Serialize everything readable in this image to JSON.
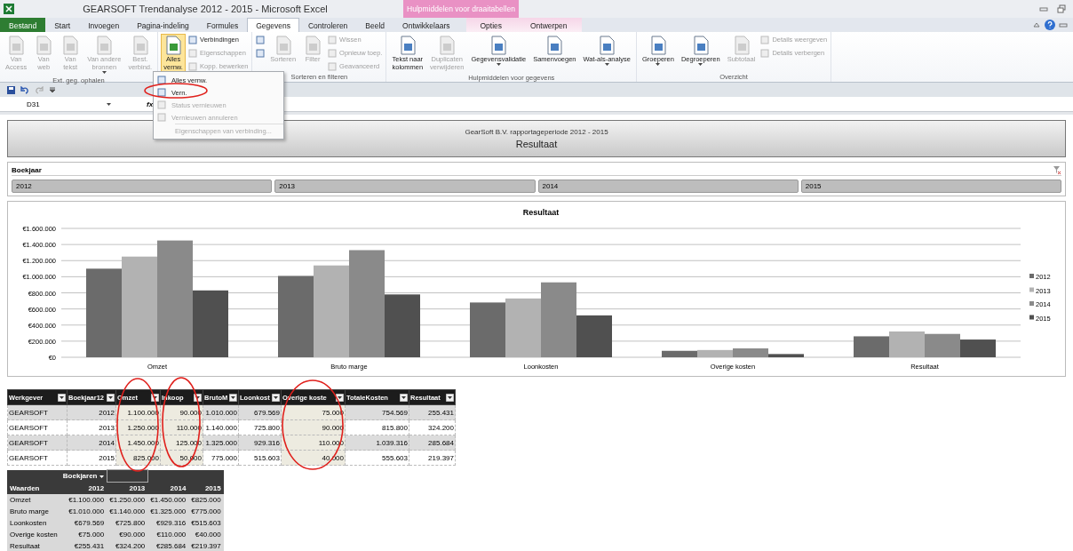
{
  "window": {
    "title": "GEARSOFT Trendanalyse 2012 - 2015  -  Microsoft Excel"
  },
  "tabs": [
    {
      "label": "Bestand",
      "kind": "file",
      "selected": false
    },
    {
      "label": "Start",
      "kind": "tab",
      "selected": false
    },
    {
      "label": "Invoegen",
      "kind": "tab",
      "selected": false
    },
    {
      "label": "Pagina-indeling",
      "kind": "tab",
      "selected": false
    },
    {
      "label": "Formules",
      "kind": "tab",
      "selected": false
    },
    {
      "label": "Gegevens",
      "kind": "tab",
      "selected": true
    },
    {
      "label": "Controleren",
      "kind": "tab",
      "selected": false
    },
    {
      "label": "Beeld",
      "kind": "tab",
      "selected": false
    },
    {
      "label": "Ontwikkelaars",
      "kind": "tab",
      "selected": false
    }
  ],
  "contextual_tabs": {
    "title": "Hulpmiddelen voor draaitabellen",
    "tabs": [
      {
        "label": "Opties",
        "selected": false
      },
      {
        "label": "Ontwerpen",
        "selected": false
      }
    ]
  },
  "ribbon_groups": [
    {
      "label": "Ext. geg. ophalen",
      "items": [
        {
          "kind": "large",
          "lines": [
            "Van",
            "Access"
          ],
          "disabled": true,
          "caret": false,
          "active": false
        },
        {
          "kind": "large",
          "lines": [
            "Van",
            "web"
          ],
          "disabled": true,
          "caret": false,
          "active": false
        },
        {
          "kind": "large",
          "lines": [
            "Van",
            "tekst"
          ],
          "disabled": true,
          "caret": false,
          "active": false
        },
        {
          "kind": "large",
          "lines": [
            "Van andere",
            "bronnen"
          ],
          "disabled": true,
          "caret": true,
          "active": false
        },
        {
          "kind": "large",
          "lines": [
            "Best.",
            "verbind."
          ],
          "disabled": true,
          "caret": false,
          "active": false
        }
      ]
    },
    {
      "items": [
        {
          "kind": "large",
          "lines": [
            "Alles",
            "vernw."
          ],
          "disabled": false,
          "caret": true,
          "active": true
        },
        {
          "kind": "small",
          "lines": [
            "Verbindingen"
          ],
          "disabled": false,
          "caret": false,
          "active": false
        },
        {
          "kind": "small",
          "lines": [
            "Eigenschappen"
          ],
          "disabled": true,
          "caret": false,
          "active": false
        },
        {
          "kind": "small",
          "lines": [
            "Kopp. bewerken"
          ],
          "disabled": true,
          "caret": false,
          "active": false
        }
      ]
    },
    {
      "label": "Sorteren en filteren",
      "items": [
        {
          "kind": "small",
          "disabled": false,
          "caret": false,
          "active": false
        },
        {
          "kind": "small",
          "disabled": false,
          "caret": false,
          "active": false
        },
        {
          "kind": "large",
          "lines": [
            "Sorteren"
          ],
          "disabled": true,
          "caret": false,
          "active": false
        },
        {
          "kind": "large",
          "lines": [
            "Filter"
          ],
          "disabled": true,
          "caret": false,
          "active": false
        },
        {
          "kind": "small",
          "lines": [
            "Wissen"
          ],
          "disabled": true,
          "caret": false,
          "active": false
        },
        {
          "kind": "small",
          "lines": [
            "Opnieuw toep."
          ],
          "disabled": true,
          "caret": false,
          "active": false
        },
        {
          "kind": "small",
          "lines": [
            "Geavanceerd"
          ],
          "disabled": true,
          "caret": false,
          "active": false
        }
      ]
    },
    {
      "label": "Hulpmiddelen voor gegevens",
      "items": [
        {
          "kind": "large",
          "lines": [
            "Tekst naar",
            "kolommen"
          ],
          "disabled": false,
          "caret": false,
          "active": false
        },
        {
          "kind": "large",
          "lines": [
            "Duplicaten",
            "verwijderen"
          ],
          "disabled": true,
          "caret": false,
          "active": false
        },
        {
          "kind": "large",
          "lines": [
            "Gegevensvalidatie"
          ],
          "disabled": false,
          "caret": true,
          "active": false
        },
        {
          "kind": "large",
          "lines": [
            "Samenvoegen"
          ],
          "disabled": false,
          "caret": false,
          "active": false
        },
        {
          "kind": "large",
          "lines": [
            "Wat-als-analyse"
          ],
          "disabled": false,
          "caret": true,
          "active": false
        }
      ]
    },
    {
      "label": "Overzicht",
      "items": [
        {
          "kind": "large",
          "lines": [
            "Groeperen"
          ],
          "disabled": false,
          "caret": true,
          "active": false
        },
        {
          "kind": "large",
          "lines": [
            "Degroeperen"
          ],
          "disabled": false,
          "caret": true,
          "active": false
        },
        {
          "kind": "large",
          "lines": [
            "Subtotaal"
          ],
          "disabled": true,
          "caret": false,
          "active": false
        },
        {
          "kind": "small",
          "lines": [
            "Details weergeven"
          ],
          "disabled": true,
          "caret": false,
          "active": false
        },
        {
          "kind": "small",
          "lines": [
            "Details verbergen"
          ],
          "disabled": true,
          "caret": false,
          "active": false
        }
      ]
    }
  ],
  "dropdown_menu": [
    {
      "label": "Alles vernw.",
      "disabled": false,
      "separator_before": false
    },
    {
      "label": "Vern.",
      "disabled": false,
      "separator_before": false
    },
    {
      "label": "Status vernieuwen",
      "disabled": true,
      "separator_before": false
    },
    {
      "label": "Vernieuwen annuleren",
      "disabled": true,
      "separator_before": false
    },
    {
      "label": "Eigenschappen van verbinding...",
      "disabled": true,
      "separator_before": true
    }
  ],
  "formula_bar": {
    "name_box": "D31",
    "function_label": "fx"
  },
  "report_header": {
    "subtitle": "GearSoft B.V. rapportageperiode  2012 - 2015",
    "title": "Resultaat"
  },
  "slicer": {
    "title": "Boekjaar",
    "items": [
      {
        "label": "2012",
        "selected": true
      },
      {
        "label": "2013",
        "selected": true
      },
      {
        "label": "2014",
        "selected": true
      },
      {
        "label": "2015",
        "selected": true
      }
    ]
  },
  "chart": {
    "chart_data": {
      "type": "bar",
      "title": "Resultaat",
      "grid": true,
      "legend": true,
      "categories": [
        "Omzet",
        "Bruto marge",
        "Loonkosten",
        "Overige kosten",
        "Resultaat"
      ],
      "ylim": [
        0,
        1600000
      ],
      "yticks": [
        {
          "value": 0,
          "label": "€0"
        },
        {
          "value": 200000,
          "label": "€200.000"
        },
        {
          "value": 400000,
          "label": "€400.000"
        },
        {
          "value": 600000,
          "label": "€600.000"
        },
        {
          "value": 800000,
          "label": "€800.000"
        },
        {
          "value": 1000000,
          "label": "€1.000.000"
        },
        {
          "value": 1200000,
          "label": "€1.200.000"
        },
        {
          "value": 1400000,
          "label": "€1.400.000"
        },
        {
          "value": 1600000,
          "label": "€1.600.000"
        }
      ],
      "series": [
        {
          "name": "2012",
          "color": "#6b6b6b",
          "values": [
            1100000,
            1010000,
            680000,
            80000,
            260000
          ]
        },
        {
          "name": "2013",
          "color": "#b2b2b2",
          "values": [
            1250000,
            1140000,
            730000,
            90000,
            320000
          ]
        },
        {
          "name": "2014",
          "color": "#8a8a8a",
          "values": [
            1450000,
            1330000,
            930000,
            110000,
            290000
          ]
        },
        {
          "name": "2015",
          "color": "#505050",
          "values": [
            830000,
            780000,
            520000,
            40000,
            220000
          ]
        }
      ]
    }
  },
  "table": {
    "columns": [
      {
        "label": "Werkgever",
        "highlighted": false
      },
      {
        "label": "Boekjaar12",
        "highlighted": false
      },
      {
        "label": "Omzet",
        "highlighted": true
      },
      {
        "label": "Inkoop",
        "highlighted": true
      },
      {
        "label": "BrutoM",
        "highlighted": false
      },
      {
        "label": "Loonkost",
        "highlighted": false
      },
      {
        "label": "Overige koste",
        "highlighted": true
      },
      {
        "label": "TotaleKosten",
        "highlighted": false
      },
      {
        "label": "Resultaat",
        "highlighted": false
      }
    ],
    "rows": [
      [
        "GEARSOFT",
        "2012",
        "1.100.000",
        "90.000",
        "1.010.000",
        "679.569",
        "75.000",
        "754.569",
        "255.431"
      ],
      [
        "GEARSOFT",
        "2013",
        "1.250.000",
        "110.000",
        "1.140.000",
        "725.800",
        "90.000",
        "815.800",
        "324.200"
      ],
      [
        "GEARSOFT",
        "2014",
        "1.450.000",
        "125.000",
        "1.325.000",
        "929.316",
        "110.000",
        "1.039.316",
        "285.684"
      ],
      [
        "GEARSOFT",
        "2015",
        "825.000",
        "50.000",
        "775.000",
        "515.603",
        "40.000",
        "555.603",
        "219.397"
      ]
    ]
  },
  "pivot": {
    "filter_label": "Boekjaren",
    "row_header": "Waarden",
    "columns": [
      "2012",
      "2013",
      "2014",
      "2015"
    ],
    "rows": [
      {
        "label": "Omzet",
        "values": [
          "€1.100.000",
          "€1.250.000",
          "€1.450.000",
          "€825.000"
        ]
      },
      {
        "label": "Bruto marge",
        "values": [
          "€1.010.000",
          "€1.140.000",
          "€1.325.000",
          "€775.000"
        ]
      },
      {
        "label": "Loonkosten",
        "values": [
          "€679.569",
          "€725.800",
          "€929.316",
          "€515.603"
        ]
      },
      {
        "label": "Overige kosten",
        "values": [
          "€75.000",
          "€90.000",
          "€110.000",
          "€40.000"
        ]
      },
      {
        "label": "Resultaat",
        "values": [
          "€255.431",
          "€324.200",
          "€285.684",
          "€219.397"
        ]
      }
    ]
  }
}
